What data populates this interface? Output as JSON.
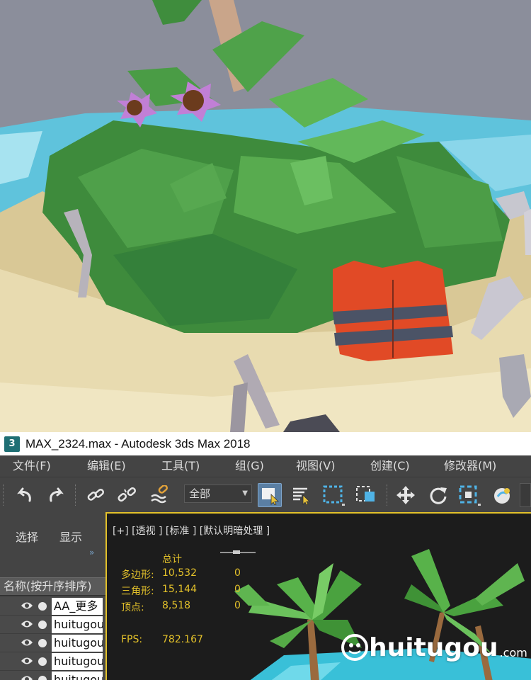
{
  "window": {
    "app_icon_text": "3",
    "title": "MAX_2324.max - Autodesk 3ds Max 2018"
  },
  "menu": [
    "文件(F)",
    "编辑(E)",
    "工具(T)",
    "组(G)",
    "视图(V)",
    "创建(C)",
    "修改器(M)"
  ],
  "toolbar": {
    "selection_filter": "全部",
    "icons": [
      "undo-icon",
      "redo-icon",
      "link-icon",
      "unlink-icon",
      "bind-spacewarp-icon",
      "select-object-icon",
      "select-by-name-icon",
      "rectangular-region-icon",
      "window-crossing-icon",
      "move-icon",
      "rotate-icon",
      "scale-icon",
      "placement-icon"
    ],
    "accent": "#4fb3e6"
  },
  "explorer": {
    "tabs": [
      "选择",
      "显示"
    ],
    "more": "»",
    "column_header": "名称(按升序排序)",
    "objects": [
      "AA_更多",
      "huitugou",
      "huitugou",
      "huitugou",
      "huitugou"
    ]
  },
  "viewport": {
    "label": "[+] [透视 ] [标准 ] [默认明暗处理 ]",
    "stats": {
      "header": "总计",
      "rows": [
        {
          "label": "多边形:",
          "value": "10,532",
          "selected": "0"
        },
        {
          "label": "三角形:",
          "value": "15,144",
          "selected": "0"
        },
        {
          "label": "顶点:",
          "value": "8,518",
          "selected": "0"
        }
      ],
      "fps_label": "FPS:",
      "fps_value": "782.167"
    },
    "border_color": "#e3c12a",
    "watermark": {
      "text": "huitugou",
      "suffix": ".com"
    }
  }
}
